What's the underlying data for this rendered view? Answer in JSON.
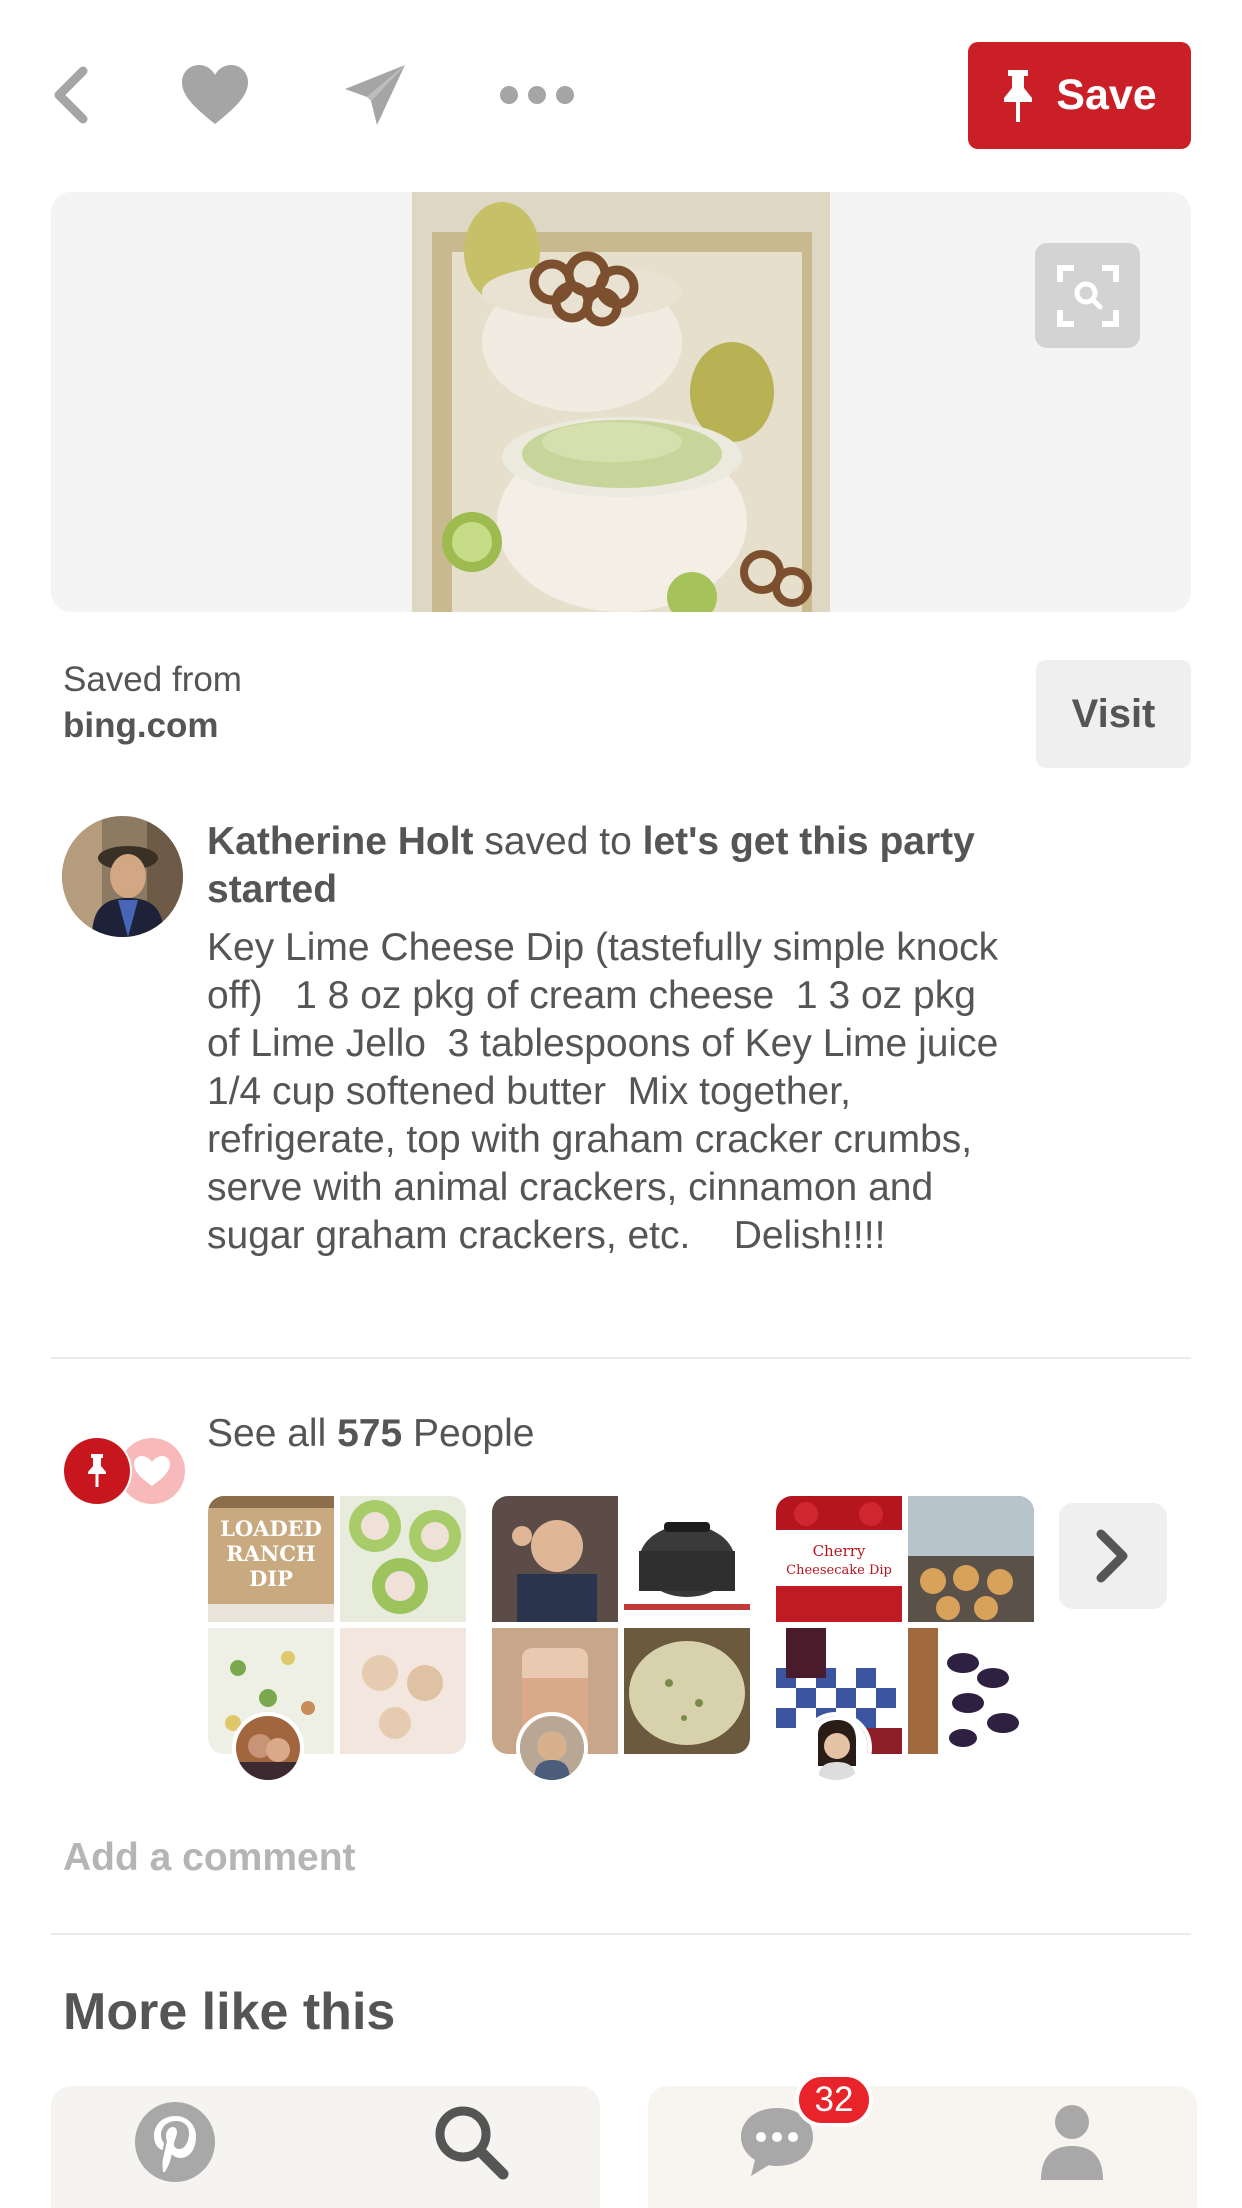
{
  "header": {
    "icons": [
      "back-icon",
      "heart-icon",
      "send-icon",
      "more-icon"
    ],
    "save_label": "Save",
    "colors": {
      "save": "#cb1f27",
      "icon": "#a5a5a5"
    }
  },
  "source": {
    "saved_from_label": "Saved from",
    "domain": "bing.com",
    "visit_label": "Visit"
  },
  "pin": {
    "pinner_name": "Katherine Holt",
    "saved_to_text": " saved to ",
    "board_name": "let's get this party started",
    "description": "Key Lime Cheese Dip (tastefully simple knock off)   1 8 oz pkg of cream cheese  1 3 oz pkg of Lime Jello  3 tablespoons of Key Lime juice  1/4 cup softened butter  Mix together, refrigerate, top with graham cracker crumbs, serve with animal crackers, cinnamon and sugar graham crackers, etc.    Delish!!!!"
  },
  "activity": {
    "see_all_prefix": "See all ",
    "count": "575",
    "see_all_suffix": " People",
    "board_previews": [
      {
        "first_tile_text": "LOADED RANCH DIP"
      },
      {
        "first_tile_text": ""
      },
      {
        "first_tile_text": "Cherry Cheesecake Dip"
      }
    ]
  },
  "comment": {
    "placeholder": "Add a comment"
  },
  "more": {
    "title": "More like this"
  },
  "bottom_nav": {
    "items": [
      "pinterest-logo-icon",
      "search-icon",
      "chat-icon",
      "profile-icon"
    ],
    "notification_count": "32"
  }
}
